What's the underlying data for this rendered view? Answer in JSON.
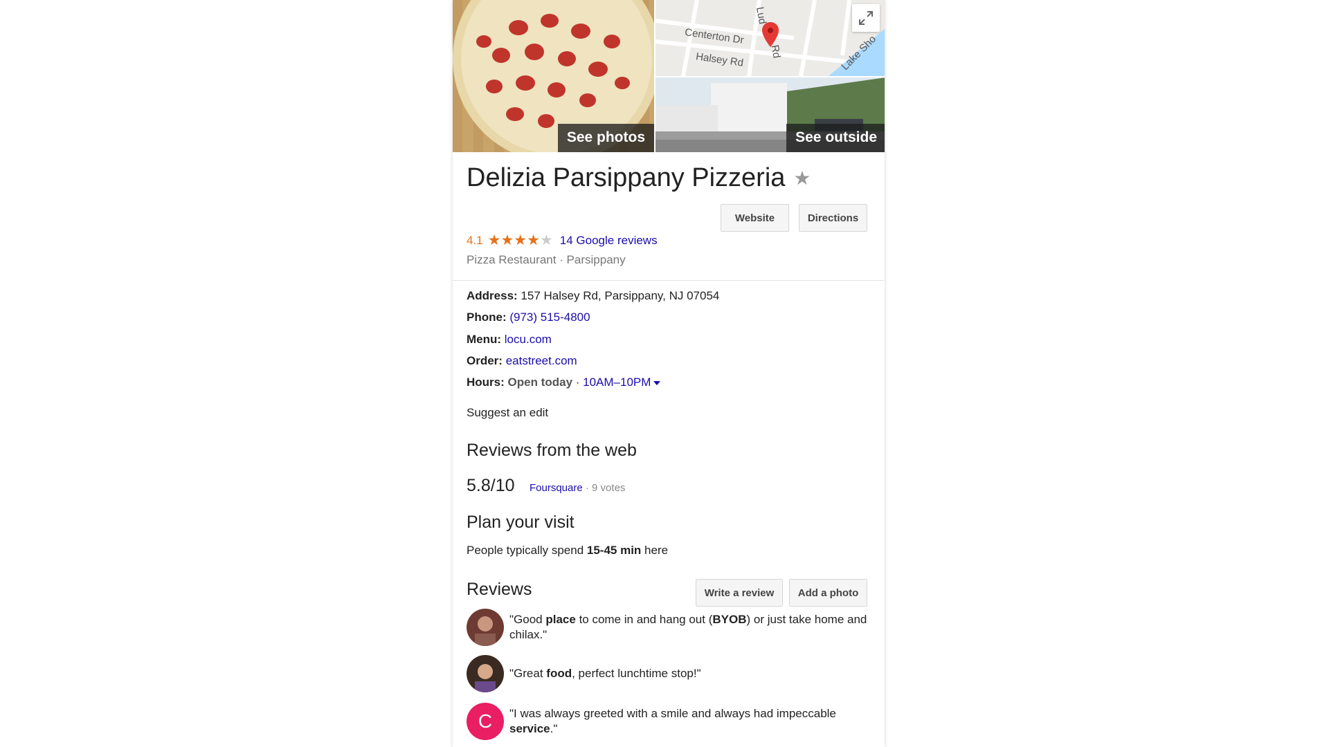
{
  "media": {
    "see_photos_label": "See photos",
    "see_outside_label": "See outside",
    "map_streets": [
      "Centerton Dr",
      "Halsey Rd",
      "Lud",
      "Rd",
      "Lake Sho"
    ]
  },
  "place": {
    "name": "Delizia Parsippany Pizzeria",
    "rating": "4.1",
    "stars_filled": 4,
    "stars_total": 5,
    "reviews_link": "14 Google reviews",
    "category": "Pizza Restaurant · Parsippany"
  },
  "actions": {
    "website_label": "Website",
    "directions_label": "Directions"
  },
  "details": {
    "address_label": "Address:",
    "address_value": "157 Halsey Rd, Parsippany, NJ 07054",
    "phone_label": "Phone:",
    "phone_value": "(973) 515-4800",
    "menu_label": "Menu:",
    "menu_value": "locu.com",
    "order_label": "Order:",
    "order_value": "eatstreet.com",
    "hours_label": "Hours:",
    "hours_status": "Open today",
    "hours_separator": " · ",
    "hours_value": "10AM–10PM",
    "suggest_edit": "Suggest an edit"
  },
  "web_reviews": {
    "title": "Reviews from the web",
    "score": "5.8/10",
    "source": "Foursquare",
    "votes": " · 9 votes"
  },
  "plan_visit": {
    "title": "Plan your visit",
    "text_before": "People typically spend ",
    "duration": "15-45 min",
    "text_after": " here"
  },
  "reviews": {
    "title": "Reviews",
    "write_review_label": "Write a review",
    "add_photo_label": "Add a photo",
    "items": [
      {
        "parts": [
          "\"Good ",
          "place",
          " to come in and hang out (",
          "BYOB",
          ") or just take home and chilax.\""
        ]
      },
      {
        "parts": [
          "\"Great ",
          "food",
          ", perfect lunchtime stop!\""
        ]
      },
      {
        "parts": [
          "\"I was always greeted with a smile and always had impeccable ",
          "service",
          ".\""
        ],
        "avatar_letter": "C"
      }
    ]
  },
  "colors": {
    "link": "#1a0dab",
    "rating_orange": "#e7711b",
    "avatar_pink": "#e91e63"
  }
}
